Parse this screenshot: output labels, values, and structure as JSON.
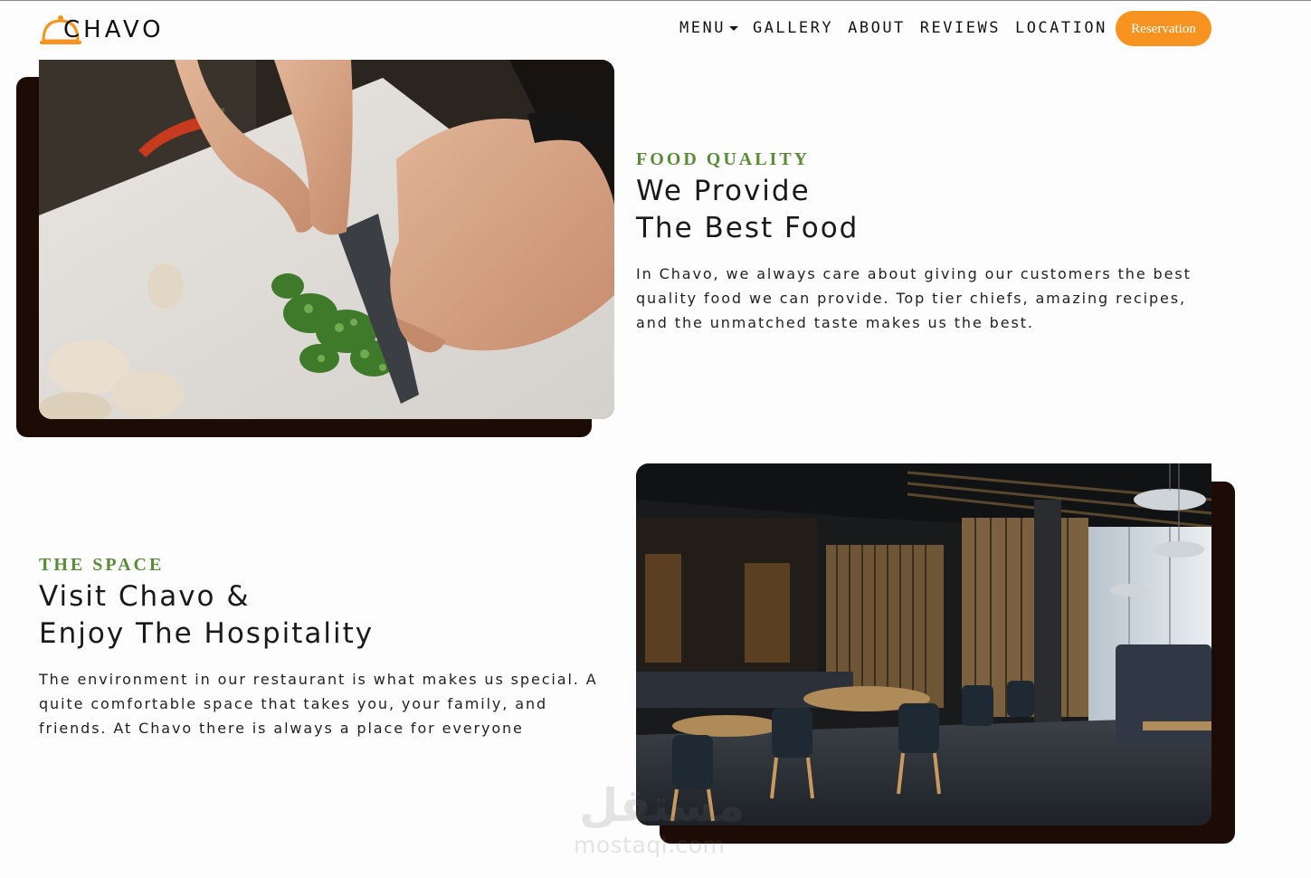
{
  "nav": {
    "brand": "CHAVO",
    "links": [
      "MENU",
      "GALLERY",
      "ABOUT",
      "REVIEWS",
      "LOCATION"
    ],
    "reservation_label": "Reservation"
  },
  "colors": {
    "accent_orange": "#f7931e",
    "eyebrow_green": "#5a8b37",
    "shadow_brown": "#1d0c05"
  },
  "food_section": {
    "eyebrow": "FOOD QUALITY",
    "heading_line1": "We Provide",
    "heading_line2": "The Best Food",
    "paragraph": "In Chavo, we always care about giving our customers the best quality food we can provide. Top tier chiefs, amazing recipes, and the unmatched taste makes us the best."
  },
  "space_section": {
    "eyebrow": "THE SPACE",
    "heading_line1": "Visit Chavo &",
    "heading_line2": "Enjoy The Hospitality",
    "paragraph": "The environment in our restaurant is what makes us special. A quite comfortable space that takes you, your family, and friends. At Chavo there is always a place for everyone"
  },
  "watermark": {
    "arabic": "مستقل",
    "latin": "mostaql.com"
  }
}
